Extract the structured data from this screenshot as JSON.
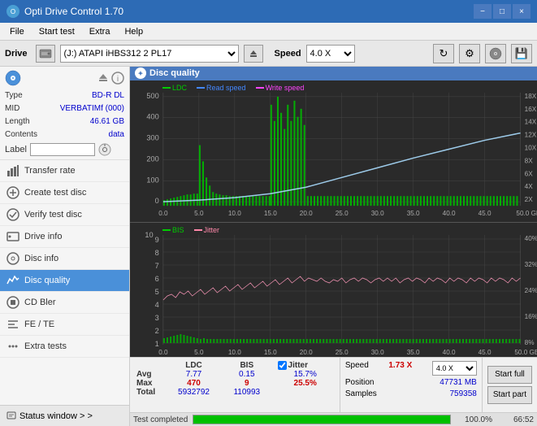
{
  "titlebar": {
    "title": "Opti Drive Control 1.70",
    "minimize": "−",
    "maximize": "□",
    "close": "×"
  },
  "menubar": {
    "items": [
      "File",
      "Start test",
      "Extra",
      "Help"
    ]
  },
  "drivebar": {
    "drive_label": "Drive",
    "drive_value": "(J:) ATAPI iHBS312  2 PL17",
    "speed_label": "Speed",
    "speed_value": "4.0 X"
  },
  "disc": {
    "type_label": "Type",
    "type_value": "BD-R DL",
    "mid_label": "MID",
    "mid_value": "VERBATIMf (000)",
    "length_label": "Length",
    "length_value": "46.61 GB",
    "contents_label": "Contents",
    "contents_value": "data",
    "label_label": "Label",
    "label_value": ""
  },
  "nav": {
    "items": [
      {
        "id": "transfer-rate",
        "label": "Transfer rate",
        "icon": "chart"
      },
      {
        "id": "create-test",
        "label": "Create test disc",
        "icon": "disc"
      },
      {
        "id": "verify-test",
        "label": "Verify test disc",
        "icon": "verify"
      },
      {
        "id": "drive-info",
        "label": "Drive info",
        "icon": "info"
      },
      {
        "id": "disc-info",
        "label": "Disc info",
        "icon": "disc-info"
      },
      {
        "id": "disc-quality",
        "label": "Disc quality",
        "icon": "quality",
        "active": true
      },
      {
        "id": "cd-bler",
        "label": "CD Bler",
        "icon": "cd"
      },
      {
        "id": "fe-te",
        "label": "FE / TE",
        "icon": "fe"
      },
      {
        "id": "extra-tests",
        "label": "Extra tests",
        "icon": "extra"
      }
    ]
  },
  "status_window": {
    "label": "Status window > >"
  },
  "disc_quality": {
    "title": "Disc quality"
  },
  "chart1": {
    "legend": {
      "ldc": "LDC",
      "read_speed": "Read speed",
      "write_speed": "Write speed"
    },
    "y_max": 500,
    "y_labels": [
      "500",
      "400",
      "300",
      "200",
      "100",
      "0"
    ],
    "y_right_labels": [
      "18X",
      "16X",
      "14X",
      "12X",
      "10X",
      "8X",
      "6X",
      "4X",
      "2X"
    ],
    "x_labels": [
      "0.0",
      "5.0",
      "10.0",
      "15.0",
      "20.0",
      "25.0",
      "30.0",
      "35.0",
      "40.0",
      "45.0",
      "50.0 GB"
    ]
  },
  "chart2": {
    "legend": {
      "bis": "BIS",
      "jitter": "Jitter"
    },
    "y_max": 10,
    "y_labels": [
      "10",
      "9",
      "8",
      "7",
      "6",
      "5",
      "4",
      "3",
      "2",
      "1"
    ],
    "y_right_labels": [
      "40%",
      "32%",
      "24%",
      "16%",
      "8%"
    ],
    "x_labels": [
      "0.0",
      "5.0",
      "10.0",
      "15.0",
      "20.0",
      "25.0",
      "30.0",
      "35.0",
      "40.0",
      "45.0",
      "50.0 GB"
    ]
  },
  "stats": {
    "headers": [
      "",
      "LDC",
      "BIS",
      "",
      "Jitter",
      "Speed",
      "",
      ""
    ],
    "rows": [
      {
        "label": "Avg",
        "ldc": "7.77",
        "bis": "0.15",
        "jitter": "15.7%"
      },
      {
        "label": "Max",
        "ldc": "470",
        "bis": "9",
        "jitter": "25.5%"
      },
      {
        "label": "Total",
        "ldc": "5932792",
        "bis": "110993",
        "jitter": ""
      }
    ],
    "jitter_checked": true,
    "speed_label": "Speed",
    "speed_value": "1.73 X",
    "speed_select": "4.0 X",
    "position_label": "Position",
    "position_value": "47731 MB",
    "samples_label": "Samples",
    "samples_value": "759358",
    "btn_start_full": "Start full",
    "btn_start_part": "Start part"
  },
  "progress": {
    "fill_percent": 100,
    "percent_text": "100.0%",
    "status_text": "Test completed",
    "time_text": "66:52"
  },
  "colors": {
    "ldc_bar": "#00cc00",
    "read_speed_line": "#00aaff",
    "write_speed_line": "#ff00ff",
    "bis_bar": "#00cc00",
    "jitter_line": "#ff88aa",
    "chart_bg": "#2a2a2a",
    "grid_line": "#444444",
    "accent_blue": "#4a7abf"
  }
}
